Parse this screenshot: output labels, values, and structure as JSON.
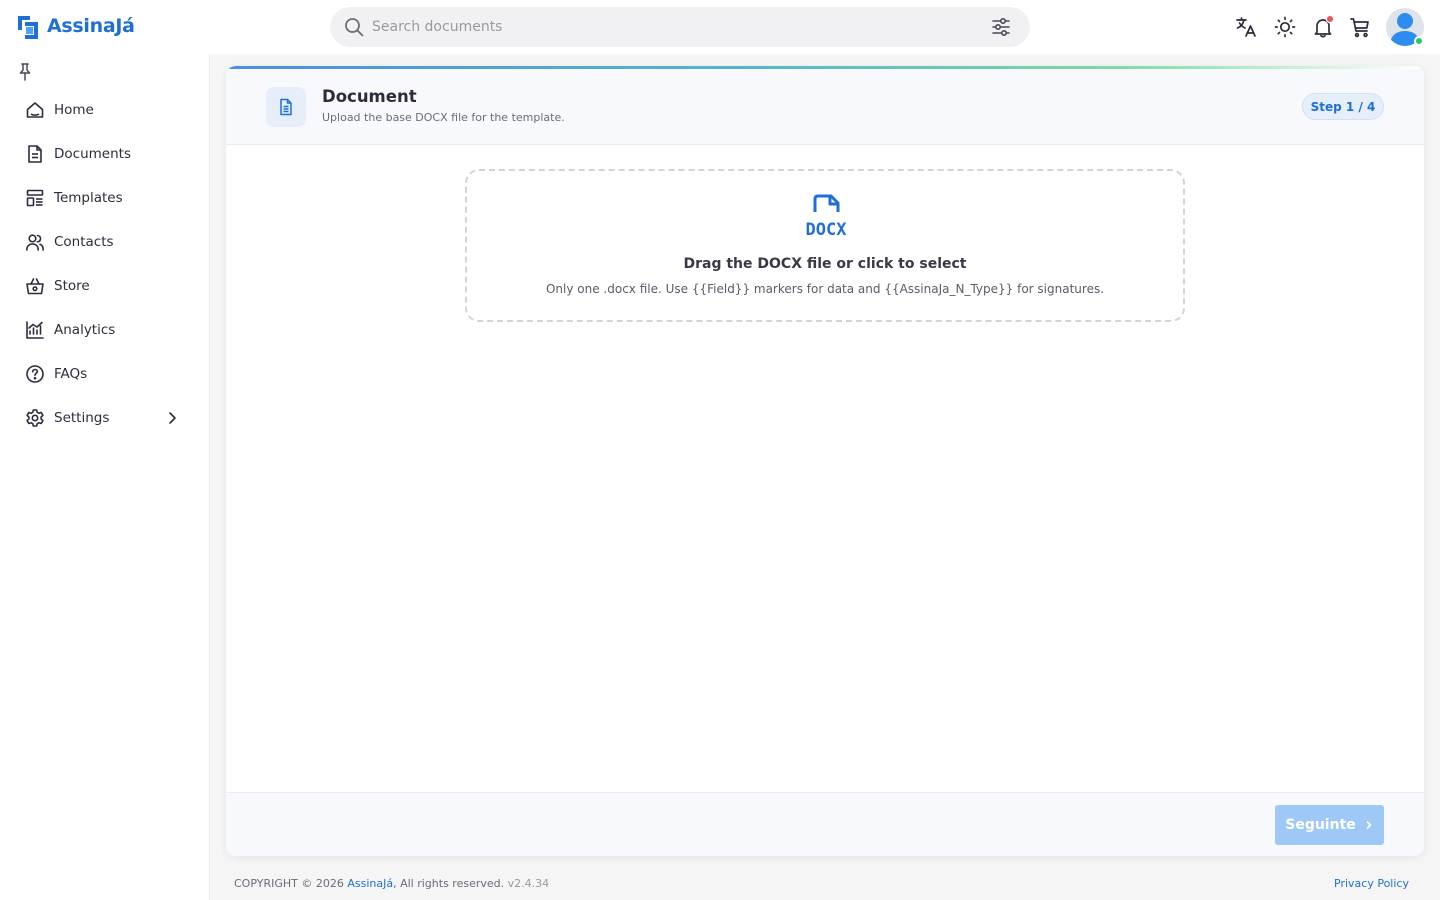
{
  "header": {
    "brand": "AssinaJá",
    "search": {
      "placeholder": "Search documents",
      "value": ""
    },
    "icons": [
      "translate-icon",
      "sun-icon",
      "bell-icon",
      "cart-icon"
    ],
    "notification_dot_color": "#ea5455",
    "avatar_status_color": "#28c76f"
  },
  "sidebar": {
    "items": [
      {
        "label": "Home",
        "icon": "home-icon"
      },
      {
        "label": "Documents",
        "icon": "document-icon"
      },
      {
        "label": "Templates",
        "icon": "template-icon"
      },
      {
        "label": "Contacts",
        "icon": "users-icon"
      },
      {
        "label": "Store",
        "icon": "basket-icon"
      },
      {
        "label": "Analytics",
        "icon": "chart-icon"
      },
      {
        "label": "FAQs",
        "icon": "help-icon"
      },
      {
        "label": "Settings",
        "icon": "gear-icon",
        "has_submenu": true
      }
    ]
  },
  "card": {
    "title": "Document",
    "subtitle": "Upload the base DOCX file for the template.",
    "step": "Step 1 / 4",
    "dropzone": {
      "icon_label": "DOCX",
      "title": "Drag the DOCX file or click to select",
      "hint": "Only one .docx file. Use {{Field}} markers for data and {{AssinaJa_N_Type}} for signatures."
    },
    "next_label": "Seguinte",
    "next_disabled": true
  },
  "footer": {
    "copyright": "COPYRIGHT © 2026",
    "brand": "AssinaJá",
    "rights": ", All rights reserved.",
    "version": "v2.4.34",
    "privacy": "Privacy Policy"
  },
  "colors": {
    "accent": "#1f6fd6",
    "button_disabled": "#9ec8f5",
    "background": "#f5f5f6"
  }
}
